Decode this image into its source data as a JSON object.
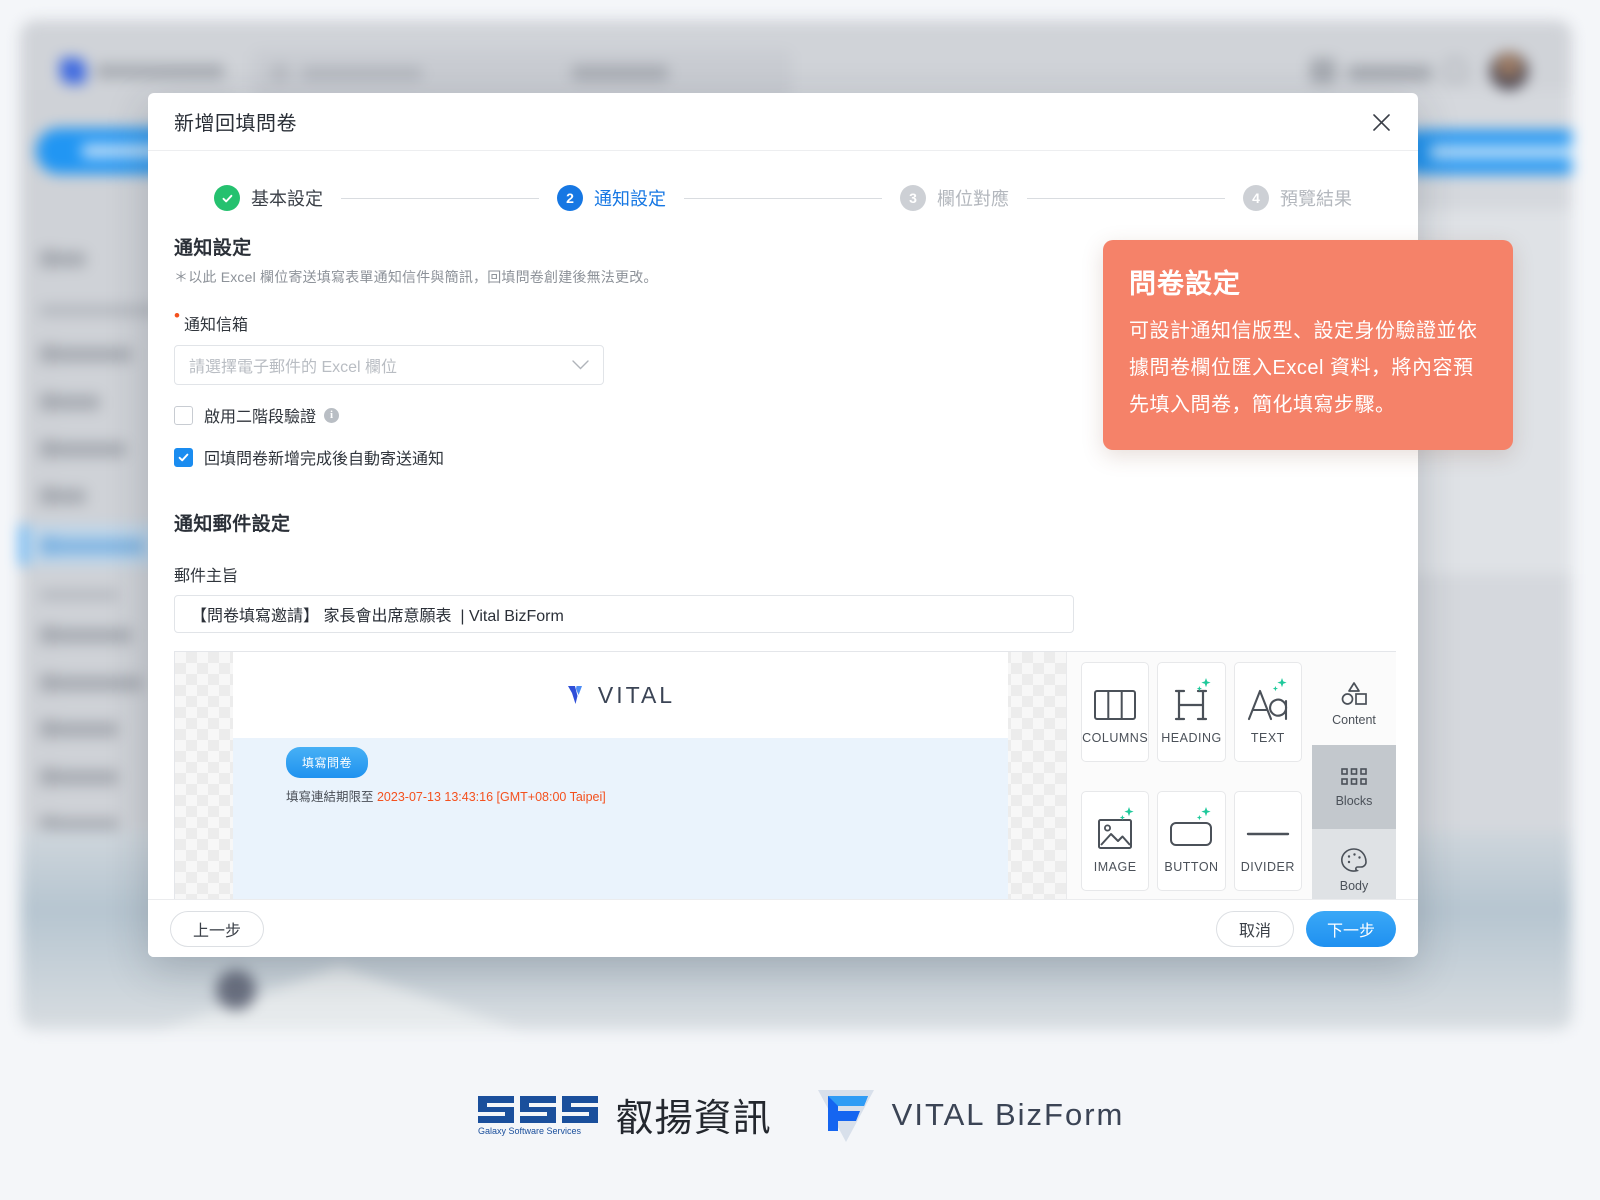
{
  "background_app": {
    "logo_name": "VITAL BizForm",
    "search_placeholder": "搜尋表單",
    "search_button": "進階搜尋",
    "top_actions": [
      "說明中心"
    ],
    "new_button": "新增表單",
    "primary_button": "新增回填問卷"
  },
  "dialog": {
    "title": "新增回填問卷",
    "close_icon": "close-icon",
    "stepper": [
      {
        "num": "✓",
        "label": "基本設定",
        "state": "done"
      },
      {
        "num": "2",
        "label": "通知設定",
        "state": "current"
      },
      {
        "num": "3",
        "label": "欄位對應",
        "state": "todo"
      },
      {
        "num": "4",
        "label": "預覽結果",
        "state": "todo"
      }
    ],
    "notify": {
      "section_title": "通知設定",
      "note": "＊以此 Excel 欄位寄送填寫表單通知信件與簡訊，回填問卷創建後無法更改。",
      "email_field_label": "通知信箱",
      "email_field_required_mark": "•",
      "email_select_placeholder": "請選擇電子郵件的 Excel 欄位",
      "caret_icon": "chevron-down-icon",
      "checkboxes": [
        {
          "label": "啟用二階段驗證",
          "checked": false,
          "has_info": true,
          "info_icon": "info-icon"
        },
        {
          "label": "回填問卷新增完成後自動寄送通知",
          "checked": true,
          "has_info": false
        }
      ]
    },
    "mail": {
      "section_title": "通知郵件設定",
      "subject_label": "郵件主旨",
      "subject_value": "【問卷填寫邀請】 家長會出席意願表  | Vital BizForm"
    },
    "preview": {
      "logo_word": "VITAL",
      "fill_button": "填寫問卷",
      "expiry_prefix": "填寫連結期限至 ",
      "expiry_date": "2023-07-13 13:43:16 [GMT+08:00 Taipei]"
    },
    "palette": {
      "blocks": [
        {
          "label": "COLUMNS",
          "icon": "columns-icon",
          "sparkle": false
        },
        {
          "label": "HEADING",
          "icon": "heading-icon",
          "sparkle": true
        },
        {
          "label": "TEXT",
          "icon": "text-icon",
          "sparkle": true
        },
        {
          "label": "IMAGE",
          "icon": "image-icon",
          "sparkle": true
        },
        {
          "label": "BUTTON",
          "icon": "button-icon",
          "sparkle": true
        },
        {
          "label": "DIVIDER",
          "icon": "divider-icon",
          "sparkle": false
        }
      ],
      "tabs": [
        {
          "label": "Content",
          "icon": "shapes-icon",
          "state": "normal"
        },
        {
          "label": "Blocks",
          "icon": "grid-dots-icon",
          "state": "active"
        },
        {
          "label": "Body",
          "icon": "palette-icon",
          "state": "half"
        }
      ]
    },
    "footer": {
      "prev": "上一步",
      "cancel": "取消",
      "next": "下一步"
    }
  },
  "callout": {
    "title": "問卷設定",
    "body": "可設計通知信版型、設定身份驗證並依據問卷欄位匯入Excel 資料，將內容預先填入問卷，簡化填寫步驟。",
    "bg_color": "#F58269"
  },
  "brand_footer": {
    "gss_mark": "GSS",
    "gss_sub": "Galaxy Software Services",
    "gss_cn": "叡揚資訊",
    "vital_bizform": "VITAL BizForm"
  }
}
